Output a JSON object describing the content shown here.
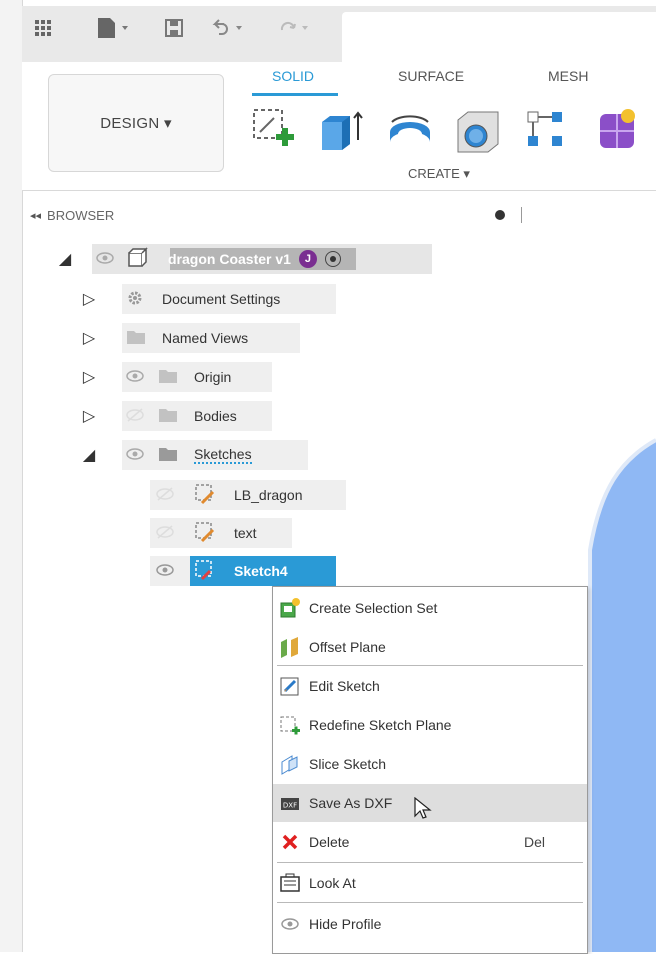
{
  "toolbar": {
    "icons": [
      "grid-icon",
      "file-icon",
      "save-icon",
      "undo-icon",
      "redo-icon"
    ],
    "design_label": "DESIGN ▾",
    "tabs": [
      {
        "label": "SOLID",
        "active": true
      },
      {
        "label": "SURFACE",
        "active": false
      },
      {
        "label": "MESH",
        "active": false
      }
    ],
    "create_label": "CREATE ▾",
    "tools": [
      "create-sketch-icon",
      "extrude-icon",
      "revolve-icon",
      "hole-icon",
      "pattern-icon",
      "new-component-icon"
    ]
  },
  "browser": {
    "title": "BROWSER",
    "root": {
      "label": "dragon Coaster v1",
      "user_badge": "J"
    },
    "nodes": [
      {
        "label": "Document Settings"
      },
      {
        "label": "Named Views"
      },
      {
        "label": "Origin"
      },
      {
        "label": "Bodies"
      },
      {
        "label": "Sketches"
      }
    ],
    "sketches": [
      {
        "label": "LB_dragon"
      },
      {
        "label": "text"
      },
      {
        "label": "Sketch4",
        "selected": true
      }
    ]
  },
  "context_menu": {
    "items": [
      {
        "label": "Create Selection Set",
        "icon": "selection-set-icon"
      },
      {
        "label": "Offset Plane",
        "icon": "offset-plane-icon"
      },
      {
        "label": "Edit Sketch",
        "icon": "edit-sketch-icon"
      },
      {
        "label": "Redefine Sketch Plane",
        "icon": "redefine-plane-icon"
      },
      {
        "label": "Slice Sketch",
        "icon": "slice-sketch-icon"
      },
      {
        "label": "Save As DXF",
        "icon": "dxf-icon",
        "hover": true
      },
      {
        "label": "Delete",
        "icon": "delete-icon",
        "shortcut": "Del"
      },
      {
        "label": "Look At",
        "icon": "look-at-icon"
      },
      {
        "label": "Hide Profile",
        "icon": "eye-icon"
      }
    ]
  },
  "colors": {
    "accent": "#2a9ad6",
    "selected_bg": "#2a9ad6",
    "viewport_blue": "#8fb8f4",
    "root_bar": "#b5b5b5"
  }
}
